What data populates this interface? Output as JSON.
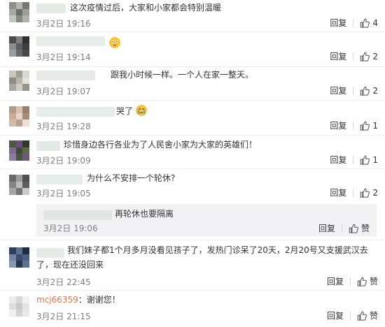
{
  "comments": [
    {
      "text": "这次疫情过后，大家和小家都会特别温暖",
      "time": "3月2日 19:16",
      "reply": "回复",
      "likes": "4"
    },
    {
      "text": "",
      "time": "3月2日 19:14",
      "reply": "回复",
      "likes": "2"
    },
    {
      "text": "跟我小时候一样。一个人在家一整天。",
      "time": "3月2日 19:07",
      "reply": "回复",
      "likes": "2"
    },
    {
      "text": "哭了",
      "time": "3月2日 19:28",
      "reply": "回复",
      "likes": "1"
    },
    {
      "text": "珍惜身边各行各业为了人民舍小家为大家的英雄们！",
      "time": "3月2日 19:09",
      "reply": "回复",
      "likes": "1"
    },
    {
      "text": "为什么不安排一个轮休?",
      "time": "3月2日 19:05",
      "reply": "回复",
      "likes": "2"
    },
    {
      "text": "我们妹子都1个月多月没看见孩子了，发热门诊呆了20天，2月20号又支援武汉去了，现在还没回来",
      "time": "3月2日 22:45",
      "reply": "回复",
      "likes_label": "赞"
    },
    {
      "user": "mcj66359",
      "text": "：谢谢您！",
      "time": "3月2日 21:15",
      "reply": "回复",
      "likes_label": "赞"
    }
  ],
  "subreply": {
    "text": "再轮休也要隔离",
    "time": "3月2日 19:06",
    "reply": "回复",
    "likes_label": "赞"
  },
  "colors": {
    "accent_link": "#eb7350",
    "text": "#333333",
    "time": "#808080",
    "subreply_bg": "#f2f2f5"
  }
}
